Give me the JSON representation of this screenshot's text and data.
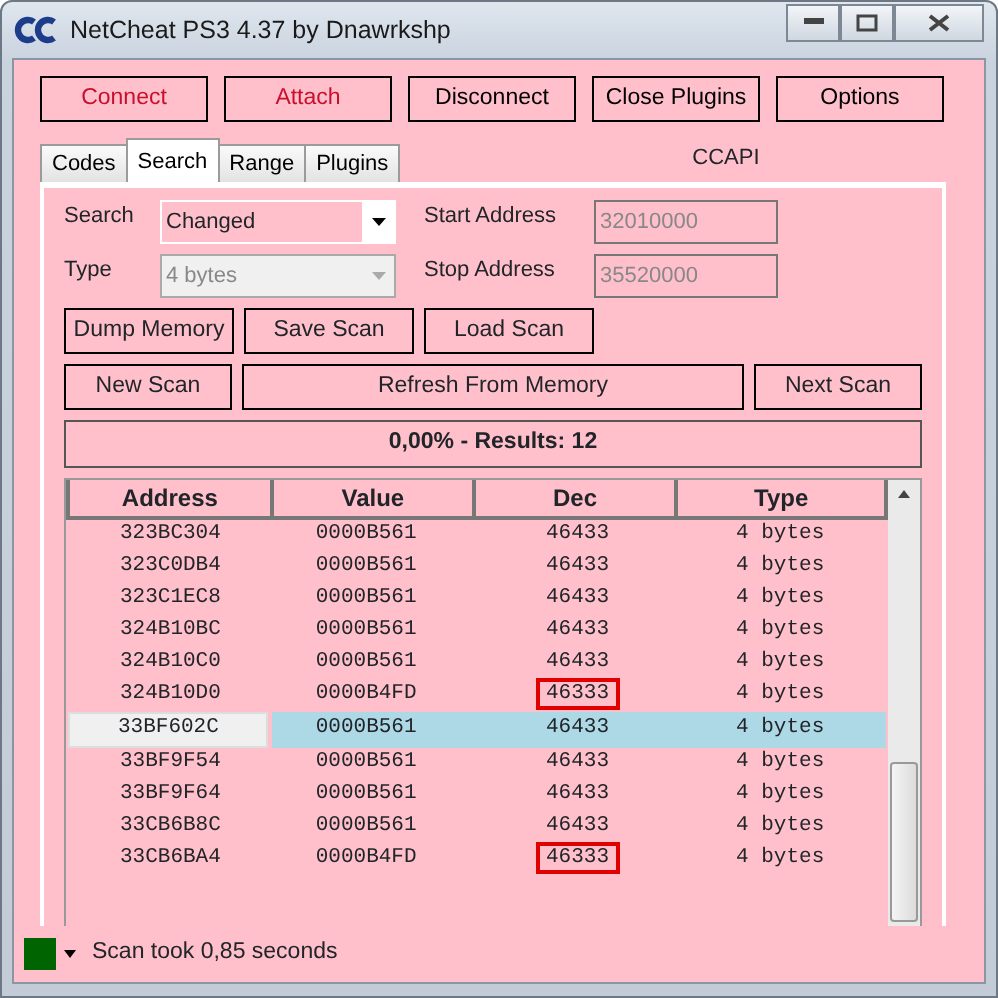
{
  "window": {
    "title": "NetCheat PS3 4.37 by Dnawrkshp"
  },
  "top_buttons": [
    {
      "label": "Connect",
      "color": "#c8102e"
    },
    {
      "label": "Attach",
      "color": "#c8102e"
    },
    {
      "label": "Disconnect",
      "color": "#000000"
    },
    {
      "label": "Close Plugins",
      "color": "#000000"
    },
    {
      "label": "Options",
      "color": "#000000"
    }
  ],
  "tabs": [
    {
      "label": "Codes",
      "selected": false
    },
    {
      "label": "Search",
      "selected": true
    },
    {
      "label": "Range",
      "selected": false
    },
    {
      "label": "Plugins",
      "selected": false
    }
  ],
  "api_label": "CCAPI",
  "search": {
    "search_label": "Search",
    "search_value": "Changed",
    "search_disabled": false,
    "type_label": "Type",
    "type_value": "4 bytes",
    "type_disabled": true,
    "start_label": "Start Address",
    "start_value": "32010000",
    "stop_label": "Stop Address",
    "stop_value": "35520000"
  },
  "action_buttons": [
    "Dump Memory",
    "Save Scan",
    "Load Scan"
  ],
  "scan_buttons": [
    "New Scan",
    "Refresh From Memory",
    "Next Scan"
  ],
  "results": "0,00% - Results: 12",
  "table": {
    "columns": [
      "Address",
      "Value",
      "Dec",
      "Type"
    ],
    "rows": [
      {
        "cells": [
          "323BC304",
          "0000B561",
          "46433",
          "4 bytes"
        ],
        "selected": false,
        "dec_marked": false
      },
      {
        "cells": [
          "323C0DB4",
          "0000B561",
          "46433",
          "4 bytes"
        ],
        "selected": false,
        "dec_marked": false
      },
      {
        "cells": [
          "323C1EC8",
          "0000B561",
          "46433",
          "4 bytes"
        ],
        "selected": false,
        "dec_marked": false
      },
      {
        "cells": [
          "324B10BC",
          "0000B561",
          "46433",
          "4 bytes"
        ],
        "selected": false,
        "dec_marked": false
      },
      {
        "cells": [
          "324B10C0",
          "0000B561",
          "46433",
          "4 bytes"
        ],
        "selected": false,
        "dec_marked": false
      },
      {
        "cells": [
          "324B10D0",
          "0000B4FD",
          "46333",
          "4 bytes"
        ],
        "selected": false,
        "dec_marked": true
      },
      {
        "cells": [
          "33BF602C",
          "0000B561",
          "46433",
          "4 bytes"
        ],
        "selected": true,
        "dec_marked": false
      },
      {
        "cells": [
          "33BF9F54",
          "0000B561",
          "46433",
          "4 bytes"
        ],
        "selected": false,
        "dec_marked": false
      },
      {
        "cells": [
          "33BF9F64",
          "0000B561",
          "46433",
          "4 bytes"
        ],
        "selected": false,
        "dec_marked": false
      },
      {
        "cells": [
          "33CB6B8C",
          "0000B561",
          "46433",
          "4 bytes"
        ],
        "selected": false,
        "dec_marked": false
      },
      {
        "cells": [
          "33CB6BA4",
          "0000B4FD",
          "46333",
          "4 bytes"
        ],
        "selected": false,
        "dec_marked": true
      }
    ]
  },
  "status_bar": {
    "color": "#006400",
    "text": "Scan took 0,85 seconds"
  }
}
